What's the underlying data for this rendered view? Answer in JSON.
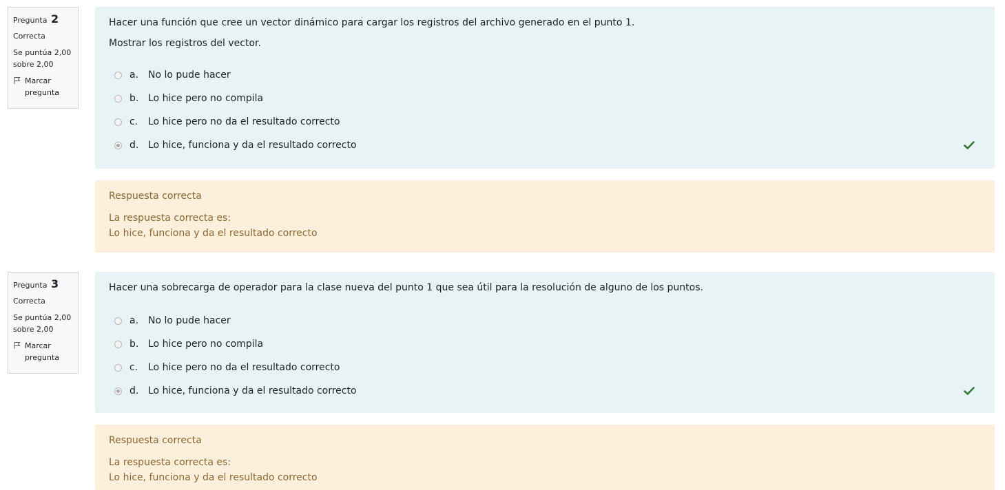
{
  "questions": [
    {
      "label": "Pregunta",
      "number": "2",
      "state": "Correcta",
      "grade": "Se puntúa 2,00 sobre 2,00",
      "flag_label": "Marcar pregunta",
      "text_lines": [
        "Hacer una función que cree un vector dinámico para cargar los registros del archivo generado en el punto 1.",
        "Mostrar los registros del vector."
      ],
      "options": [
        {
          "letter": "a.",
          "text": "No lo pude hacer",
          "selected": false
        },
        {
          "letter": "b.",
          "text": "Lo hice pero no compila",
          "selected": false
        },
        {
          "letter": "c.",
          "text": "Lo hice pero no da el resultado correcto",
          "selected": false
        },
        {
          "letter": "d.",
          "text": "Lo hice, funciona y da el resultado correcto",
          "selected": true
        }
      ],
      "feedback": {
        "title": "Respuesta correcta",
        "intro": "La respuesta correcta es:",
        "answer": "Lo hice, funciona y da el resultado correcto"
      }
    },
    {
      "label": "Pregunta",
      "number": "3",
      "state": "Correcta",
      "grade": "Se puntúa 2,00 sobre 2,00",
      "flag_label": "Marcar pregunta",
      "text_lines": [
        "Hacer una sobrecarga de operador para la clase nueva del punto 1 que sea útil para la resolución de alguno de los puntos."
      ],
      "options": [
        {
          "letter": "a.",
          "text": "No lo pude hacer",
          "selected": false
        },
        {
          "letter": "b.",
          "text": "Lo hice pero no compila",
          "selected": false
        },
        {
          "letter": "c.",
          "text": "Lo hice pero no da el resultado correcto",
          "selected": false
        },
        {
          "letter": "d.",
          "text": "Lo hice, funciona y da el resultado correcto",
          "selected": true
        }
      ],
      "feedback": {
        "title": "Respuesta correcta",
        "intro": "La respuesta correcta es:",
        "answer": "Lo hice, funciona y da el resultado correcto"
      }
    }
  ],
  "icons": {
    "flag": "flag-icon",
    "correct": "check-icon"
  },
  "colors": {
    "formulation_bg": "#e7f3f5",
    "feedback_bg": "#fcefdc",
    "feedback_text": "#8e662e",
    "correct_check": "#357a32"
  }
}
